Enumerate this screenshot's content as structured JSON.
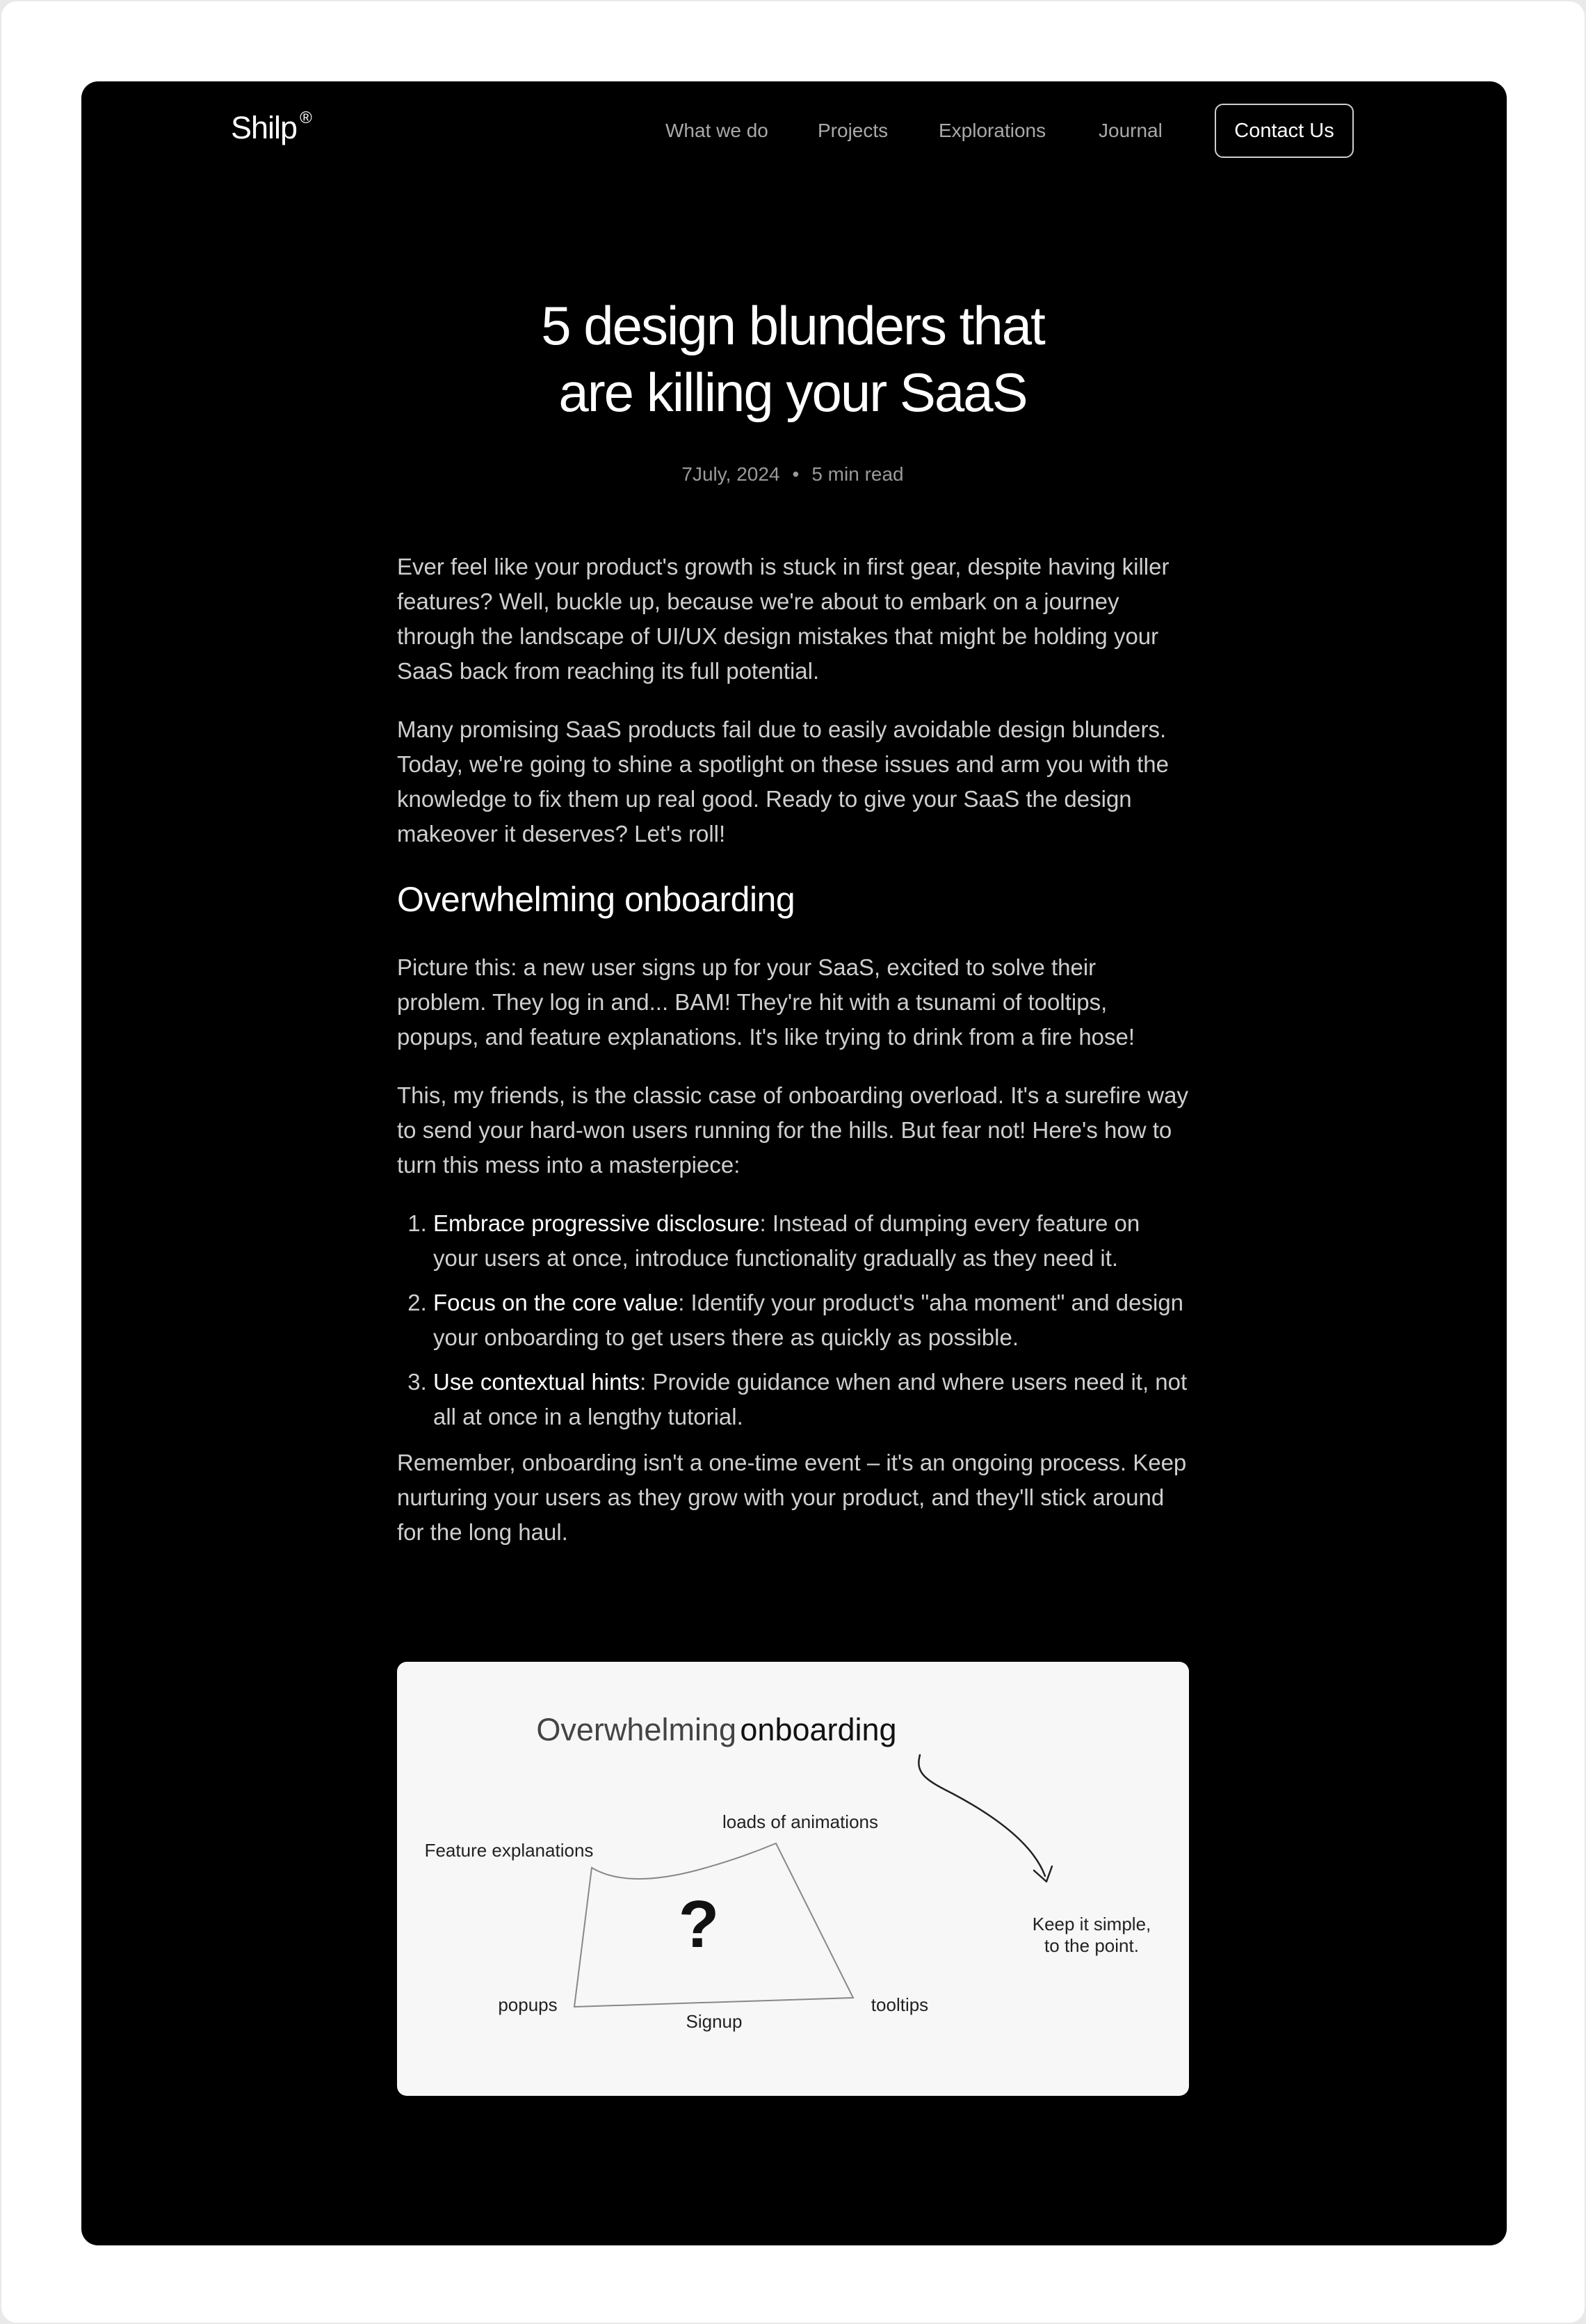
{
  "header": {
    "logo": "Shilp",
    "logo_mark": "®",
    "nav": [
      "What we do",
      "Projects",
      "Explorations",
      "Journal"
    ],
    "contact_label": "Contact Us"
  },
  "post": {
    "title_line1": "5 design blunders that",
    "title_line2": "are killing your SaaS",
    "date": "7July, 2024",
    "separator": "•",
    "read_time": "5 min read"
  },
  "article": {
    "intro_p1": "Ever feel like your product's growth is stuck in first gear, despite having killer features? Well, buckle up, because we're about to embark on a journey through the landscape of UI/UX design mistakes that might be holding your SaaS back from reaching its full potential.",
    "intro_p2": "Many promising SaaS products fail due to easily avoidable design blunders. Today, we're going to shine a spotlight on these issues and arm you with the knowledge to fix them up real good. Ready to give your SaaS the design makeover it deserves? Let's roll!",
    "section1_heading": "Overwhelming onboarding",
    "section1_p1": "Picture this: a new user signs up for your SaaS, excited to solve their problem. They log in and... BAM! They're hit with a tsunami of tooltips, popups, and feature explanations. It's like trying to drink from a fire hose!",
    "section1_p2": "This, my friends, is the classic case of onboarding overload. It's a surefire way to send your hard-won users running for the hills. But fear not! Here's how to turn this mess into a masterpiece:",
    "tips": [
      {
        "strong": "Embrace progressive disclosure",
        "text": ": Instead of dumping every feature on your users at once, introduce functionality gradually as they need it."
      },
      {
        "strong": "Focus on the core value",
        "text": ": Identify your product's \"aha moment\" and design your onboarding to get users there as quickly as possible."
      },
      {
        "strong": "Use contextual hints",
        "text": ": Provide guidance when and where users need it, not all at once in a lengthy tutorial."
      }
    ],
    "section1_p3": "Remember, onboarding isn't a one-time event – it's an ongoing process. Keep nurturing your users as they grow with your product, and they'll stick around for the long haul."
  },
  "illustration": {
    "title_light": "Overwhelming",
    "title_bold": "onboarding",
    "label_animations": "loads of animations",
    "label_features": "Feature explanations",
    "label_popups": "popups",
    "label_signup": "Signup",
    "label_tooltips": "tooltips",
    "question_mark": "?",
    "note_line1": "Keep it simple,",
    "note_line2": "to the point."
  }
}
